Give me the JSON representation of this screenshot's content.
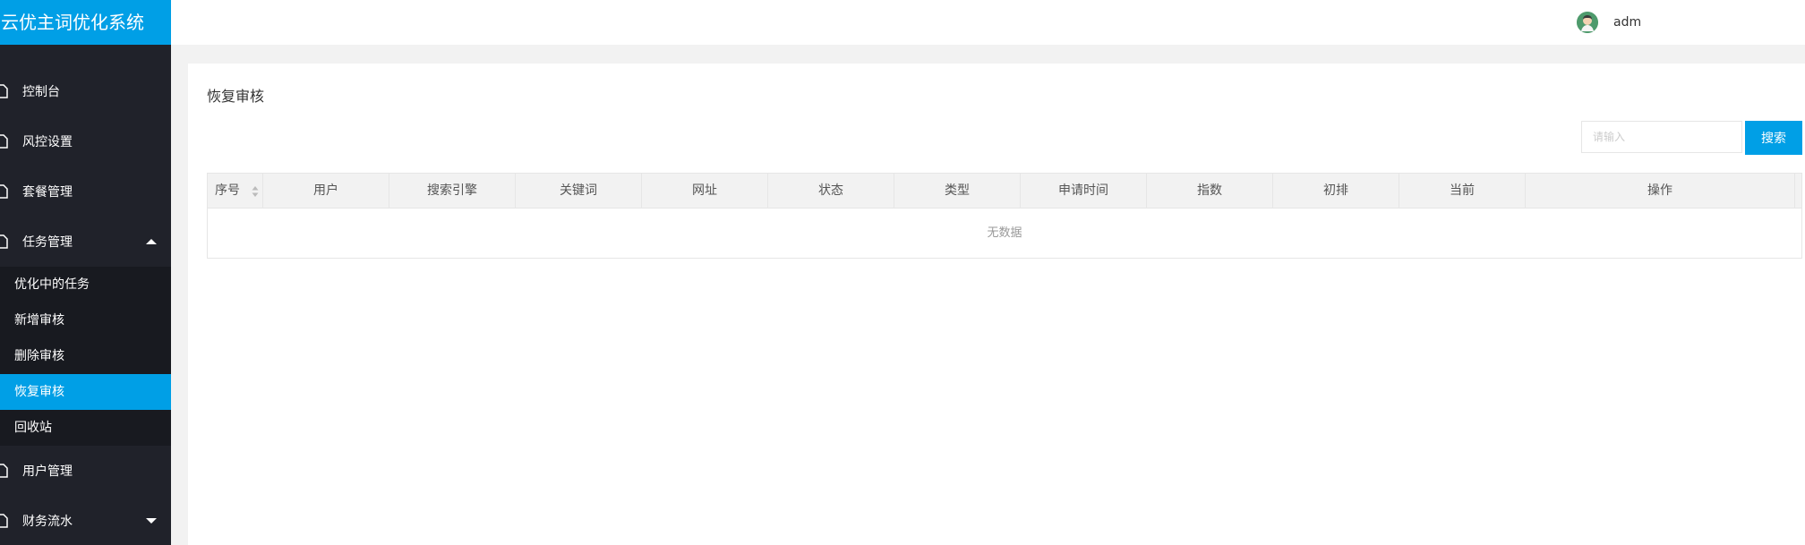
{
  "app_title": "云优主词优化系统",
  "user": {
    "name": "adm"
  },
  "sidebar": {
    "items": [
      {
        "label": "控制台",
        "icon": "file-icon"
      },
      {
        "label": "风控设置",
        "icon": "file-icon"
      },
      {
        "label": "套餐管理",
        "icon": "file-icon"
      },
      {
        "label": "任务管理",
        "icon": "file-icon",
        "expanded": true
      },
      {
        "label": "用户管理",
        "icon": "file-icon"
      },
      {
        "label": "财务流水",
        "icon": "file-icon",
        "expanded": false
      }
    ],
    "task_submenu": [
      {
        "label": "优化中的任务"
      },
      {
        "label": "新增审核"
      },
      {
        "label": "删除审核"
      },
      {
        "label": "恢复审核",
        "active": true
      },
      {
        "label": "回收站"
      }
    ]
  },
  "page": {
    "title": "恢复审核",
    "search": {
      "placeholder": "请输入",
      "value": "",
      "button_label": "搜索"
    },
    "table": {
      "columns": [
        "序号",
        "用户",
        "搜索引擎",
        "关键词",
        "网址",
        "状态",
        "类型",
        "申请时间",
        "指数",
        "初排",
        "当前",
        "操作"
      ],
      "empty_text": "无数据"
    }
  },
  "colors": {
    "accent": "#009fe6",
    "sidebar_bg": "#20222a",
    "submenu_bg": "#181a20"
  }
}
